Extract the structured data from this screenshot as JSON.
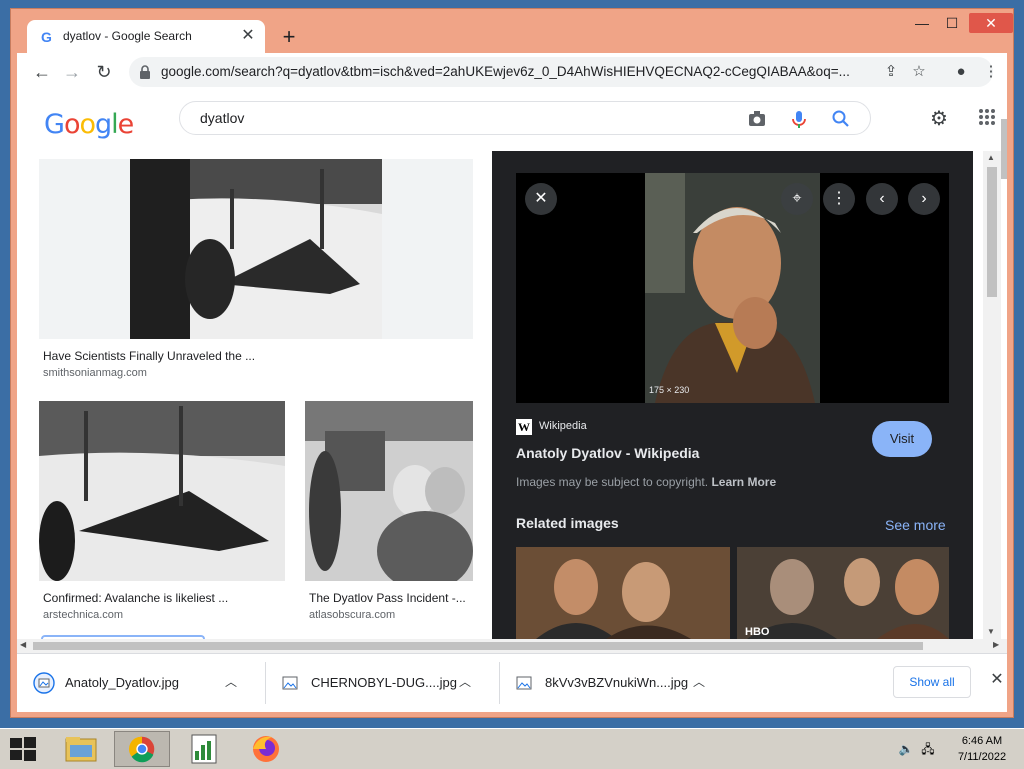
{
  "browser": {
    "tab_title": "dyatlov - Google Search",
    "tab_close": "✕",
    "new_tab": "+",
    "url": "google.com/search?q=dyatlov&tbm=isch&ved=2ahUKEwjev6z_0_D4AhWisHIEHVQECNAQ2-cCegQIABAA&oq=...",
    "window_controls": {
      "minimize": "—",
      "maximize": "☐",
      "close": "✕"
    }
  },
  "google": {
    "logo_letters": [
      {
        "ch": "G",
        "color": "#4285f4"
      },
      {
        "ch": "o",
        "color": "#ea4335"
      },
      {
        "ch": "o",
        "color": "#fbbc05"
      },
      {
        "ch": "g",
        "color": "#4285f4"
      },
      {
        "ch": "l",
        "color": "#34a853"
      },
      {
        "ch": "e",
        "color": "#ea4335"
      }
    ],
    "query": "dyatlov"
  },
  "results": [
    {
      "title": "Have Scientists Finally Unraveled the ...",
      "source": "smithsonianmag.com"
    },
    {
      "title": "Confirmed: Avalanche is likeliest ...",
      "source": "arstechnica.com"
    },
    {
      "title": "The Dyatlov Pass Incident -...",
      "source": "atlasobscura.com"
    }
  ],
  "panel": {
    "dimensions": "175 × 230",
    "source": "Wikipedia",
    "title": "Anatoly Dyatlov - Wikipedia",
    "visit": "Visit",
    "copyright": "Images may be subject to copyright.",
    "learn_more": "Learn More",
    "related": "Related images",
    "see_more": "See more"
  },
  "downloads": {
    "items": [
      {
        "name": "Anatoly_Dyatlov.jpg"
      },
      {
        "name": "CHERNOBYL-DUG....jpg"
      },
      {
        "name": "8kVv3vBZVnukiWn....jpg"
      }
    ],
    "show_all": "Show all"
  },
  "taskbar": {
    "time": "6:46 AM",
    "date": "7/11/2022"
  },
  "colors": {
    "window_frame": "#f0a487",
    "panel_bg": "#202124",
    "link_blue": "#8ab4f8",
    "visit_button": "#8ab4f8"
  }
}
